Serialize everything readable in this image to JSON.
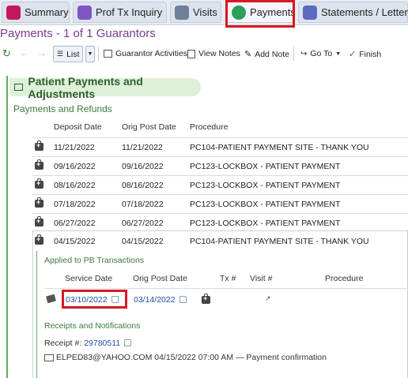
{
  "tabs": [
    {
      "label": "Summary"
    },
    {
      "label": "Prof Tx Inquiry"
    },
    {
      "label": "Visits"
    },
    {
      "label": "Payments"
    },
    {
      "label": "Statements / Letters"
    }
  ],
  "page_title": "Payments - 1 of 1 Guarantors",
  "toolbar": {
    "list": "List",
    "guarantor_activities": "Guarantor Activities",
    "view_notes": "View Notes",
    "add_note": "Add Note",
    "go_to": "Go To",
    "finish": "Finish"
  },
  "section": {
    "title": "Patient Payments and Adjustments",
    "subtitle": "Payments and Refunds"
  },
  "payments_table": {
    "headers": [
      "Deposit Date",
      "Orig Post Date",
      "Procedure"
    ],
    "rows": [
      {
        "deposit": "11/21/2022",
        "orig": "11/21/2022",
        "procedure": "PC104-PATIENT PAYMENT SITE - THANK YOU"
      },
      {
        "deposit": "09/16/2022",
        "orig": "09/16/2022",
        "procedure": "PC123-LOCKBOX - PATIENT PAYMENT"
      },
      {
        "deposit": "08/16/2022",
        "orig": "08/16/2022",
        "procedure": "PC123-LOCKBOX - PATIENT PAYMENT"
      },
      {
        "deposit": "07/18/2022",
        "orig": "07/18/2022",
        "procedure": "PC123-LOCKBOX - PATIENT PAYMENT"
      },
      {
        "deposit": "06/27/2022",
        "orig": "06/27/2022",
        "procedure": "PC123-LOCKBOX - PATIENT PAYMENT"
      },
      {
        "deposit": "04/15/2022",
        "orig": "04/15/2022",
        "procedure": "PC104-PATIENT PAYMENT SITE - THANK YOU"
      }
    ]
  },
  "applied": {
    "heading": "Applied to PB Transactions",
    "headers": [
      "Service Date",
      "Orig Post Date",
      "Tx #",
      "Visit #",
      "Procedure"
    ],
    "row": {
      "service_date": "03/10/2022",
      "orig_post_date": "03/14/2022"
    }
  },
  "receipts": {
    "heading": "Receipts and Notifications",
    "receipt_label": "Receipt #:",
    "receipt_number": "29780511",
    "notification": "ELPED83@YAHOO.COM 04/15/2022 07:00 AM — Payment confirmation"
  },
  "colors": {
    "highlight": "#d71920",
    "accent_green": "#5bb05b",
    "title_purple": "#7a3b8f",
    "link_blue": "#1f4fa8"
  }
}
